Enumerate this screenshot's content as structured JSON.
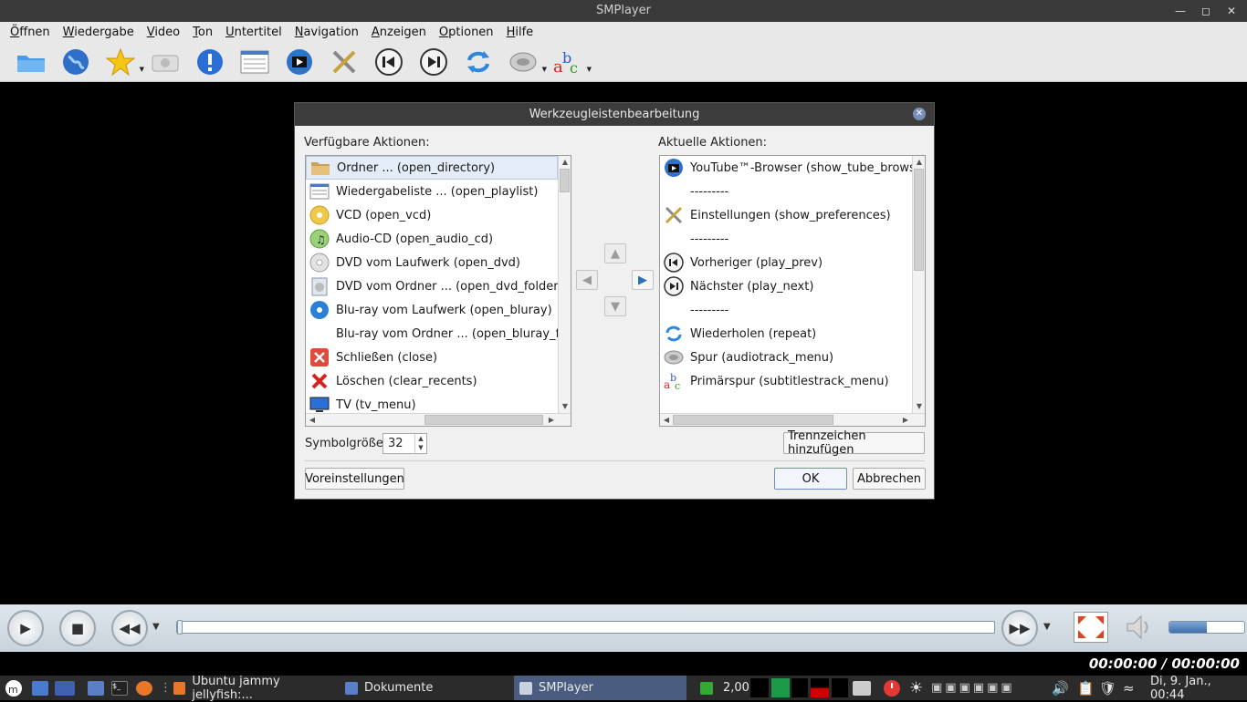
{
  "window": {
    "title": "SMPlayer"
  },
  "menu": [
    "Öffnen",
    "Wiedergabe",
    "Video",
    "Ton",
    "Untertitel",
    "Navigation",
    "Anzeigen",
    "Optionen",
    "Hilfe"
  ],
  "toolbar_icons": [
    "folder-icon",
    "globe-icon",
    "favorites-star-icon",
    "screenshot-icon",
    "info-icon",
    "playlist-icon",
    "youtube-browser-icon",
    "preferences-tools-icon",
    "previous-icon",
    "next-icon",
    "repeat-icon",
    "audio-track-icon",
    "subtitle-track-icon"
  ],
  "dialog": {
    "title": "Werkzeugleistenbearbeitung",
    "available_label": "Verfügbare Aktionen:",
    "current_label": "Aktuelle Aktionen:",
    "available": [
      {
        "label": "Ordner ... (open_directory)",
        "icon": "folder-icon",
        "selected": true
      },
      {
        "label": "Wiedergabeliste ... (open_playlist)",
        "icon": "playlist-icon"
      },
      {
        "label": "VCD (open_vcd)",
        "icon": "vcd-icon"
      },
      {
        "label": "Audio-CD (open_audio_cd)",
        "icon": "audio-cd-icon"
      },
      {
        "label": "DVD vom Laufwerk (open_dvd)",
        "icon": "dvd-icon"
      },
      {
        "label": "DVD vom Ordner ... (open_dvd_folder)",
        "icon": "dvd-folder-icon"
      },
      {
        "label": "Blu-ray vom Laufwerk (open_bluray)",
        "icon": "bluray-icon"
      },
      {
        "label": "Blu-ray vom Ordner ... (open_bluray_folde",
        "icon": ""
      },
      {
        "label": "Schließen (close)",
        "icon": "close-icon"
      },
      {
        "label": "Löschen (clear_recents)",
        "icon": "delete-icon"
      },
      {
        "label": "TV (tv_menu)",
        "icon": "tv-icon"
      }
    ],
    "current": [
      {
        "label": "YouTube™-Browser (show_tube_browser)",
        "icon": "youtube-browser-icon"
      },
      {
        "label": "---------",
        "icon": ""
      },
      {
        "label": "Einstellungen (show_preferences)",
        "icon": "preferences-tools-icon"
      },
      {
        "label": "---------",
        "icon": ""
      },
      {
        "label": "Vorheriger (play_prev)",
        "icon": "previous-icon"
      },
      {
        "label": "Nächster (play_next)",
        "icon": "next-icon"
      },
      {
        "label": "---------",
        "icon": ""
      },
      {
        "label": "Wiederholen (repeat)",
        "icon": "repeat-icon"
      },
      {
        "label": "Spur (audiotrack_menu)",
        "icon": "audio-track-icon"
      },
      {
        "label": "Primärspur (subtitlestrack_menu)",
        "icon": "subtitle-track-icon"
      }
    ],
    "icon_size_label": "Symbolgröße",
    "icon_size_value": "32",
    "add_separator": "Trennzeichen hinzufügen",
    "defaults": "Voreinstellungen",
    "ok": "OK",
    "cancel": "Abbrechen"
  },
  "player": {
    "time": "00:00:00 / 00:00:00",
    "volume_level": 0.5,
    "seek_position": 0
  },
  "panel": {
    "tasks": [
      "Ubuntu jammy jellyfish:...",
      "Dokumente",
      "SMPlayer"
    ],
    "cpu": "2,00",
    "clock": "Di, 9. Jan., 00:44"
  }
}
